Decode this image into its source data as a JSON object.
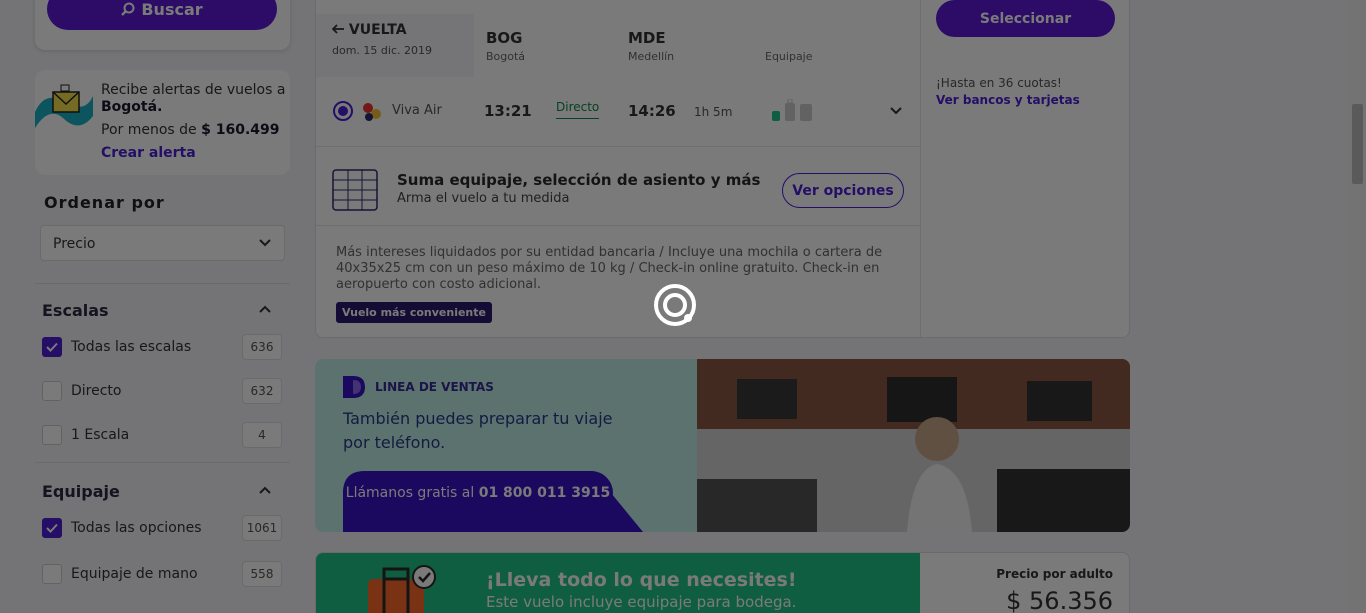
{
  "search": {
    "button_label": "Buscar"
  },
  "alert": {
    "line1": "Recibe alertas de vuelos a",
    "city": "Bogotá.",
    "price_prefix": "Por menos de",
    "price": "$ 160.499",
    "link": "Crear alerta"
  },
  "sort": {
    "label": "Ordenar por",
    "selected": "Precio"
  },
  "stops": {
    "title": "Escalas",
    "options": [
      {
        "label": "Todas las escalas",
        "count": "636",
        "checked": true
      },
      {
        "label": "Directo",
        "count": "632",
        "checked": false
      },
      {
        "label": "1 Escala",
        "count": "4",
        "checked": false
      }
    ]
  },
  "baggage": {
    "title": "Equipaje",
    "options": [
      {
        "label": "Todas las opciones",
        "count": "1061",
        "checked": true
      },
      {
        "label": "Equipaje de mano",
        "count": "558",
        "checked": false
      }
    ]
  },
  "flight": {
    "leg_title": "VUELTA",
    "leg_date": "dom. 15 dic. 2019",
    "origin_code": "BOG",
    "origin_city": "Bogotá",
    "dest_code": "MDE",
    "dest_city": "Medellín",
    "baggage_header": "Equipaje",
    "airline": "Viva Air",
    "depart": "13:21",
    "stop_type": "Directo",
    "arrive": "14:26",
    "duration": "1h 5m",
    "upsell_title": "Suma equipaje, selección de asiento y más",
    "upsell_sub": "Arma el vuelo a tu medida",
    "upsell_button": "Ver opciones",
    "notes": "Más intereses liquidados por su entidad bancaria / Incluye una mochila o cartera de 40x35x25 cm con un peso máximo de 10 kg / Check-in online gratuito. Check-in en aeropuerto con costo adicional.",
    "badge": "Vuelo más conveniente",
    "select_button": "Seleccionar",
    "installments": "¡Hasta en 36 cuotas!",
    "banks_link": "Ver bancos y tarjetas"
  },
  "sales": {
    "tag": "LINEA DE VENTAS",
    "text": "También puedes preparar tu viaje por teléfono.",
    "cta_prefix": "Llámanos gratis al",
    "cta_phone": "01 800 011 3915"
  },
  "luggage": {
    "title": "¡Lleva todo lo que necesites!",
    "subtitle": "Este vuelo incluye equipaje para bodega.",
    "price_label": "Precio por adulto",
    "price": "$ 56.356"
  },
  "colors": {
    "brand": "#5c1bd6",
    "accent_green": "#23c48a",
    "overlay": "rgba(0,0,0,0.52)"
  }
}
